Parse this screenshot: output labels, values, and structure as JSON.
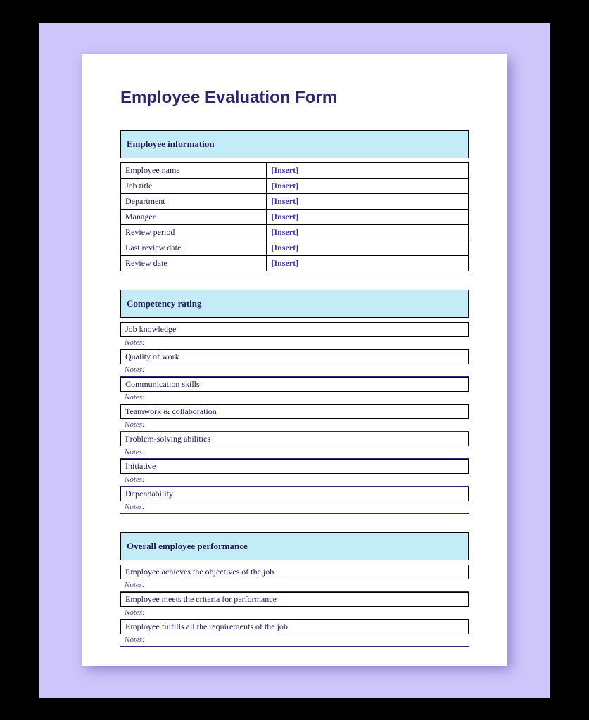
{
  "title": "Employee Evaluation Form",
  "sections": {
    "employee_info": {
      "header": "Employee information",
      "rows": [
        {
          "label": "Employee name",
          "value": "[Insert]"
        },
        {
          "label": "Job title",
          "value": "[Insert]"
        },
        {
          "label": "Department",
          "value": "[Insert]"
        },
        {
          "label": "Manager",
          "value": "[Insert]"
        },
        {
          "label": "Review period",
          "value": "[Insert]"
        },
        {
          "label": "Last review date",
          "value": "[Insert]"
        },
        {
          "label": "Review date",
          "value": "[Insert]"
        }
      ]
    },
    "competency": {
      "header": "Competency rating",
      "items": [
        {
          "label": "Job knowledge",
          "notes": "Notes:"
        },
        {
          "label": "Quality of work",
          "notes": "Notes:"
        },
        {
          "label": "Communication skills",
          "notes": "Notes:"
        },
        {
          "label": "Teamwork & collaboration",
          "notes": "Notes:"
        },
        {
          "label": "Problem-solving abilities",
          "notes": "Notes:"
        },
        {
          "label": "Initiative",
          "notes": "Notes:"
        },
        {
          "label": "Dependability",
          "notes": "Notes:"
        }
      ]
    },
    "overall": {
      "header": "Overall employee performance",
      "items": [
        {
          "label": "Employee achieves the objectives of the job",
          "notes": "Notes:"
        },
        {
          "label": "Employee meets the criteria for performance",
          "notes": "Notes:"
        },
        {
          "label": "Employee fulfills all the requirements of the job",
          "notes": "Notes:"
        }
      ]
    }
  }
}
